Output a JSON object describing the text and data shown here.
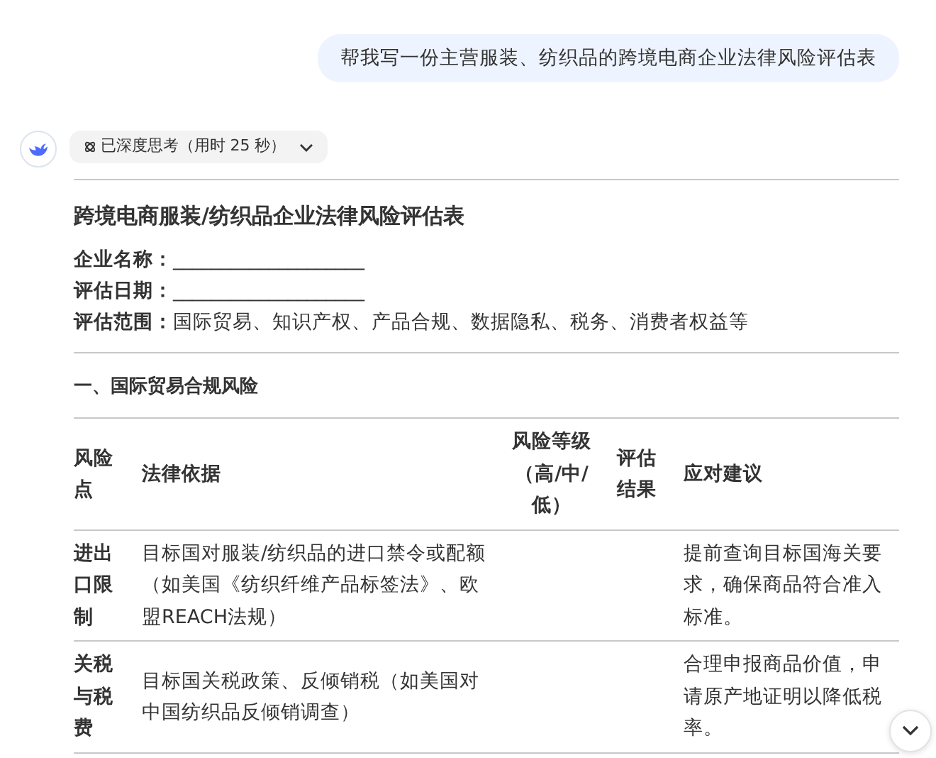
{
  "user_message": "帮我写一份主营服装、纺织品的跨境电商企业法律风险评估表",
  "thinking_chip": {
    "label": "已深度思考（用时 25 秒）",
    "expanded": false
  },
  "document": {
    "title": "跨境电商服装/纺织品企业法律风险评估表",
    "fields": [
      {
        "label": "企业名称：",
        "value": "____________________"
      },
      {
        "label": "评估日期：",
        "value": "____________________"
      },
      {
        "label": "评估范围：",
        "value": "国际贸易、知识产权、产品合规、数据隐私、税务、消费者权益等"
      }
    ],
    "section_heading": "一、国际贸易合规风险",
    "table": {
      "columns": [
        "风险点",
        "法律依据",
        "风险等级（高/中/低）",
        "评估结果",
        "应对建议"
      ],
      "rows": [
        [
          "进出口限制",
          "目标国对服装/纺织品的进口禁令或配额（如美国《纺织纤维产品标签法》、欧盟REACH法规）",
          "",
          "",
          "提前查询目标国海关要求，确保商品符合准入标准。"
        ],
        [
          "关税与税费",
          "目标国关税政策、反倾销税（如美国对中国纺织品反倾销调查）",
          "",
          "",
          "合理申报商品价值，申请原产地证明以降低税率。"
        ]
      ]
    }
  }
}
